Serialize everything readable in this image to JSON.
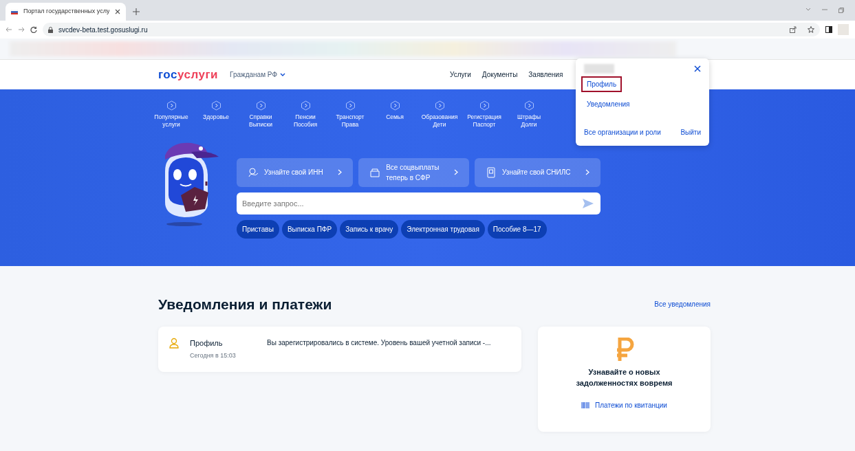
{
  "browser": {
    "tab_title": "Портал государственных услу",
    "url": "svcdev-beta.test.gosuslugi.ru"
  },
  "header": {
    "logo": [
      "гос",
      "услуги"
    ],
    "region": "Гражданам РФ",
    "nav": [
      "Услуги",
      "Документы",
      "Заявления"
    ]
  },
  "categories": [
    {
      "label": "Популярные\nуслуги"
    },
    {
      "label": "Здоровье"
    },
    {
      "label": "Справки\nВыписки"
    },
    {
      "label": "Пенсии\nПособия"
    },
    {
      "label": "Транспорт\nПрава"
    },
    {
      "label": "Семья"
    },
    {
      "label": "Образования\nДети"
    },
    {
      "label": "Регистрация\nПаспорт"
    },
    {
      "label": "Штрафы\nДолги"
    }
  ],
  "promos": [
    {
      "kind": "inn",
      "text": "Узнайте свой ИНН"
    },
    {
      "kind": "wallet",
      "text": "Все соцвыплаты\nтеперь в СФР"
    },
    {
      "kind": "snils",
      "text": "Узнайте свой СНИЛС"
    }
  ],
  "search": {
    "placeholder": "Введите запрос..."
  },
  "quick_links": [
    "Приставы",
    "Выписка ПФР",
    "Запись к врачу",
    "Электронная трудовая",
    "Пособие 8—17"
  ],
  "profile_menu": {
    "items": [
      {
        "label": "Профиль",
        "selected": true
      },
      {
        "label": "Уведомления",
        "selected": false
      }
    ],
    "organizations": "Все организации и роли",
    "logout": "Выйти"
  },
  "notifications": {
    "title": "Уведомления и платежи",
    "all_link": "Все уведомления",
    "items": [
      {
        "title": "Профиль",
        "time": "Сегодня в 15:03",
        "text": "Вы зарегистрировались в системе. Уровень вашей учетной записи -..."
      }
    ],
    "debt_card": {
      "title": "Узнавайте о новых\nзадолженностях вовремя",
      "link": "Платежи по квитанции"
    }
  }
}
